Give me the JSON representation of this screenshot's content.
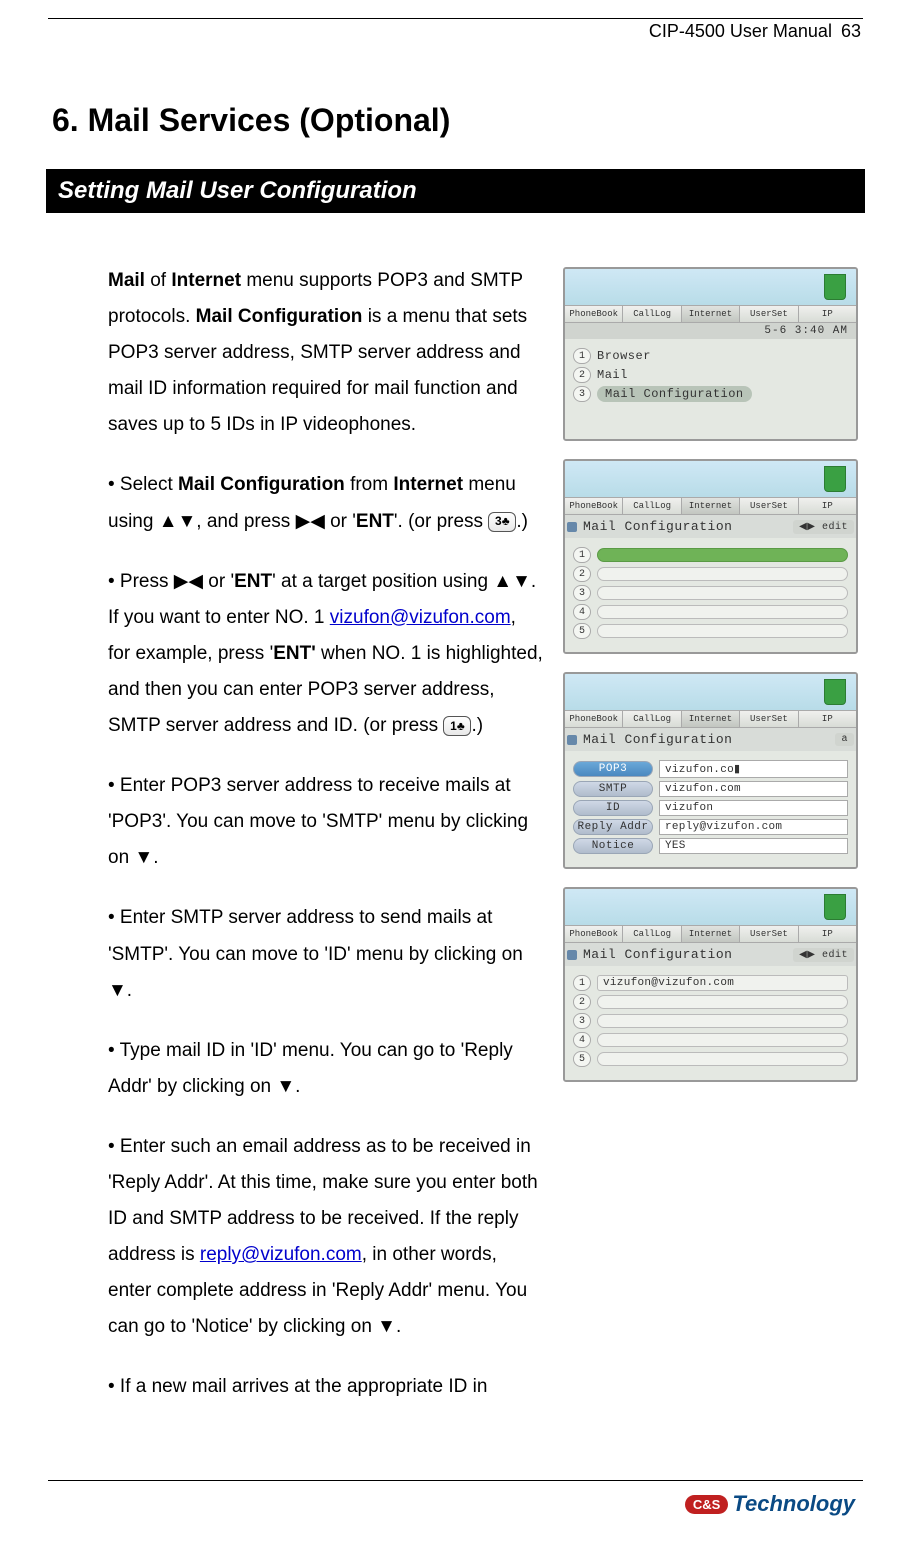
{
  "header": {
    "doc_title": "CIP-4500 User Manual",
    "page_num": "63"
  },
  "chapter": {
    "title": "6. Mail Services (Optional)"
  },
  "section": {
    "title": "Setting Mail User Configuration"
  },
  "intro": {
    "t1": "Mail",
    "t2": " of ",
    "t3": "Internet",
    "t4": " menu supports POP3 and SMTP protocols. ",
    "t5": "Mail Configuration",
    "t6": " is a menu that sets POP3 server address, SMTP server address and mail ID information required for mail function and saves up to 5 IDs in IP videophones."
  },
  "p1": {
    "a": "•  Select ",
    "b": "Mail Configuration",
    "c": " from ",
    "d": "Internet",
    "e": " menu using ▲▼, and press ▶◀ or '",
    "f": "ENT",
    "g": "'. (or press ",
    "btn": "3♣",
    "h": ".)"
  },
  "p2": {
    "a": "• Press ▶◀ or '",
    "b": "ENT",
    "c": "' at a target position using ▲▼. If you want to enter NO. 1 ",
    "link": "vizufon@vizufon.com",
    "d": ", for example, press '",
    "e": "ENT'",
    "f": " when NO. 1 is highlighted, and then you can enter POP3 server address, SMTP server address and ID. (or press ",
    "btn": "1♣",
    "g": ".)"
  },
  "p3": "• Enter POP3 server address to receive mails at 'POP3'. You can move to 'SMTP' menu by clicking on ▼.",
  "p4": "• Enter SMTP server address to send mails at 'SMTP'. You can move to 'ID' menu by clicking on ▼.",
  "p5": "• Type mail ID in 'ID' menu. You can go to 'Reply Addr' by clicking on ▼.",
  "p6": {
    "a": "• Enter such an email address as to be received in 'Reply Addr'. At this time, make sure you enter both ID and SMTP address to be received. If the reply address is ",
    "link": "reply@vizufon.com",
    "b": ", in other words, enter complete address in 'Reply Addr' menu. You can go to 'Notice' by clicking on ▼."
  },
  "p7": "• If a new mail arrives at the appropriate ID in",
  "screens": {
    "tabs": [
      "PhoneBook",
      "CallLog",
      "Internet",
      "UserSet",
      "IP"
    ],
    "time": "5-6  3:40 AM",
    "s1": {
      "items": [
        "Browser",
        "Mail",
        "Mail Configuration"
      ]
    },
    "s2": {
      "title": "Mail Configuration",
      "badge": "◀▶ edit"
    },
    "s3": {
      "title": "Mail Configuration",
      "corner": "a",
      "rows": [
        {
          "label": "POP3",
          "val": "vizufon.co▮",
          "hl": true
        },
        {
          "label": "SMTP",
          "val": "vizufon.com"
        },
        {
          "label": "ID",
          "val": "vizufon"
        },
        {
          "label": "Reply Addr",
          "val": "reply@vizufon.com"
        },
        {
          "label": "Notice",
          "val": "YES"
        }
      ]
    },
    "s4": {
      "title": "Mail Configuration",
      "badge": "◀▶ edit",
      "entry": "vizufon@vizufon.com"
    }
  },
  "footer": {
    "badge": "C&S",
    "brand": "Technology"
  }
}
